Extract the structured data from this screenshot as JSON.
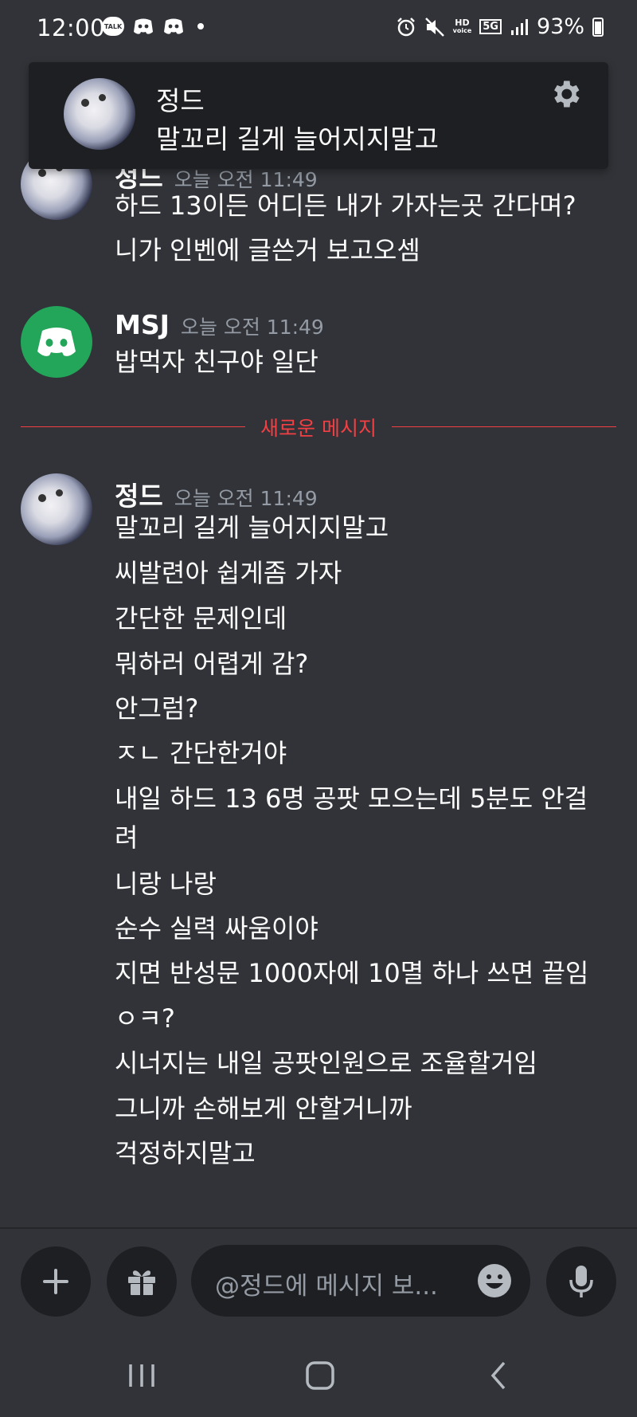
{
  "status_bar": {
    "time": "12:00",
    "battery_percent": "93%",
    "talk_badge": "TALK",
    "hd_label": "HD",
    "hd_sub": "voice",
    "network": "5G"
  },
  "notification": {
    "sender": "정드",
    "message": "말꼬리 길게 늘어지지말고",
    "icons": [
      "settings-gear-icon"
    ]
  },
  "messages": [
    {
      "author": "정드",
      "time": "오늘 오전 11:49",
      "lines": [
        "하드 13이든 어디든 내가 가자는곳 간다며?",
        "니가 인벤에 글쓴거 보고오셈"
      ]
    },
    {
      "author": "MSJ",
      "time": "오늘 오전 11:49",
      "lines": [
        "밥먹자 친구야  일단"
      ]
    },
    {
      "author": "정드",
      "time": "오늘 오전 11:49",
      "lines": [
        "말꼬리 길게 늘어지지말고",
        "씨발련아 쉽게좀 가자",
        "간단한 문제인데",
        "뭐하러 어렵게 감?",
        "안그럼?",
        "ㅈㄴ 간단한거야",
        "내일 하드 13 6명 공팟 모으는데 5분도 안걸려",
        "니랑 나랑",
        "순수 실력 싸움이야",
        "지면 반성문 1000자에 10멸 하나 쓰면 끝임",
        "ㅇㅋ?",
        "시너지는 내일 공팟인원으로 조율할거임",
        "그니까 손해보게 안할거니까",
        "걱정하지말고"
      ]
    }
  ],
  "divider": {
    "label": "새로운 메시지",
    "color": "#f23f43"
  },
  "composer": {
    "placeholder": "@정드에 메시지 보...",
    "icons": [
      "plus-icon",
      "gift-icon",
      "emoji-icon",
      "microphone-icon"
    ]
  },
  "nav": {
    "icons": [
      "recent-apps-icon",
      "home-icon",
      "back-icon"
    ]
  },
  "colors": {
    "background": "#313338",
    "surface": "#1e1f22",
    "discord_green": "#23a55a",
    "muted_text": "#949ba4"
  }
}
